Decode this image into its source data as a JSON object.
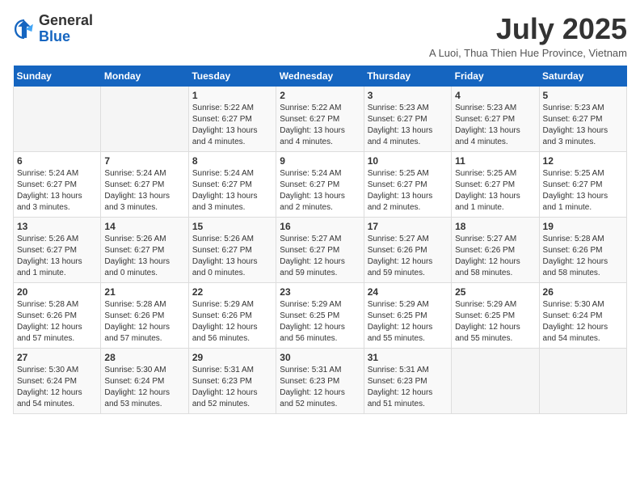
{
  "header": {
    "logo": {
      "general": "General",
      "blue": "Blue"
    },
    "month_title": "July 2025",
    "subtitle": "A Luoi, Thua Thien Hue Province, Vietnam"
  },
  "days_of_week": [
    "Sunday",
    "Monday",
    "Tuesday",
    "Wednesday",
    "Thursday",
    "Friday",
    "Saturday"
  ],
  "weeks": [
    [
      {
        "day": "",
        "sunrise": "",
        "sunset": "",
        "daylight": ""
      },
      {
        "day": "",
        "sunrise": "",
        "sunset": "",
        "daylight": ""
      },
      {
        "day": "1",
        "sunrise": "Sunrise: 5:22 AM",
        "sunset": "Sunset: 6:27 PM",
        "daylight": "Daylight: 13 hours and 4 minutes."
      },
      {
        "day": "2",
        "sunrise": "Sunrise: 5:22 AM",
        "sunset": "Sunset: 6:27 PM",
        "daylight": "Daylight: 13 hours and 4 minutes."
      },
      {
        "day": "3",
        "sunrise": "Sunrise: 5:23 AM",
        "sunset": "Sunset: 6:27 PM",
        "daylight": "Daylight: 13 hours and 4 minutes."
      },
      {
        "day": "4",
        "sunrise": "Sunrise: 5:23 AM",
        "sunset": "Sunset: 6:27 PM",
        "daylight": "Daylight: 13 hours and 4 minutes."
      },
      {
        "day": "5",
        "sunrise": "Sunrise: 5:23 AM",
        "sunset": "Sunset: 6:27 PM",
        "daylight": "Daylight: 13 hours and 3 minutes."
      }
    ],
    [
      {
        "day": "6",
        "sunrise": "Sunrise: 5:24 AM",
        "sunset": "Sunset: 6:27 PM",
        "daylight": "Daylight: 13 hours and 3 minutes."
      },
      {
        "day": "7",
        "sunrise": "Sunrise: 5:24 AM",
        "sunset": "Sunset: 6:27 PM",
        "daylight": "Daylight: 13 hours and 3 minutes."
      },
      {
        "day": "8",
        "sunrise": "Sunrise: 5:24 AM",
        "sunset": "Sunset: 6:27 PM",
        "daylight": "Daylight: 13 hours and 3 minutes."
      },
      {
        "day": "9",
        "sunrise": "Sunrise: 5:24 AM",
        "sunset": "Sunset: 6:27 PM",
        "daylight": "Daylight: 13 hours and 2 minutes."
      },
      {
        "day": "10",
        "sunrise": "Sunrise: 5:25 AM",
        "sunset": "Sunset: 6:27 PM",
        "daylight": "Daylight: 13 hours and 2 minutes."
      },
      {
        "day": "11",
        "sunrise": "Sunrise: 5:25 AM",
        "sunset": "Sunset: 6:27 PM",
        "daylight": "Daylight: 13 hours and 1 minute."
      },
      {
        "day": "12",
        "sunrise": "Sunrise: 5:25 AM",
        "sunset": "Sunset: 6:27 PM",
        "daylight": "Daylight: 13 hours and 1 minute."
      }
    ],
    [
      {
        "day": "13",
        "sunrise": "Sunrise: 5:26 AM",
        "sunset": "Sunset: 6:27 PM",
        "daylight": "Daylight: 13 hours and 1 minute."
      },
      {
        "day": "14",
        "sunrise": "Sunrise: 5:26 AM",
        "sunset": "Sunset: 6:27 PM",
        "daylight": "Daylight: 13 hours and 0 minutes."
      },
      {
        "day": "15",
        "sunrise": "Sunrise: 5:26 AM",
        "sunset": "Sunset: 6:27 PM",
        "daylight": "Daylight: 13 hours and 0 minutes."
      },
      {
        "day": "16",
        "sunrise": "Sunrise: 5:27 AM",
        "sunset": "Sunset: 6:27 PM",
        "daylight": "Daylight: 12 hours and 59 minutes."
      },
      {
        "day": "17",
        "sunrise": "Sunrise: 5:27 AM",
        "sunset": "Sunset: 6:26 PM",
        "daylight": "Daylight: 12 hours and 59 minutes."
      },
      {
        "day": "18",
        "sunrise": "Sunrise: 5:27 AM",
        "sunset": "Sunset: 6:26 PM",
        "daylight": "Daylight: 12 hours and 58 minutes."
      },
      {
        "day": "19",
        "sunrise": "Sunrise: 5:28 AM",
        "sunset": "Sunset: 6:26 PM",
        "daylight": "Daylight: 12 hours and 58 minutes."
      }
    ],
    [
      {
        "day": "20",
        "sunrise": "Sunrise: 5:28 AM",
        "sunset": "Sunset: 6:26 PM",
        "daylight": "Daylight: 12 hours and 57 minutes."
      },
      {
        "day": "21",
        "sunrise": "Sunrise: 5:28 AM",
        "sunset": "Sunset: 6:26 PM",
        "daylight": "Daylight: 12 hours and 57 minutes."
      },
      {
        "day": "22",
        "sunrise": "Sunrise: 5:29 AM",
        "sunset": "Sunset: 6:26 PM",
        "daylight": "Daylight: 12 hours and 56 minutes."
      },
      {
        "day": "23",
        "sunrise": "Sunrise: 5:29 AM",
        "sunset": "Sunset: 6:25 PM",
        "daylight": "Daylight: 12 hours and 56 minutes."
      },
      {
        "day": "24",
        "sunrise": "Sunrise: 5:29 AM",
        "sunset": "Sunset: 6:25 PM",
        "daylight": "Daylight: 12 hours and 55 minutes."
      },
      {
        "day": "25",
        "sunrise": "Sunrise: 5:29 AM",
        "sunset": "Sunset: 6:25 PM",
        "daylight": "Daylight: 12 hours and 55 minutes."
      },
      {
        "day": "26",
        "sunrise": "Sunrise: 5:30 AM",
        "sunset": "Sunset: 6:24 PM",
        "daylight": "Daylight: 12 hours and 54 minutes."
      }
    ],
    [
      {
        "day": "27",
        "sunrise": "Sunrise: 5:30 AM",
        "sunset": "Sunset: 6:24 PM",
        "daylight": "Daylight: 12 hours and 54 minutes."
      },
      {
        "day": "28",
        "sunrise": "Sunrise: 5:30 AM",
        "sunset": "Sunset: 6:24 PM",
        "daylight": "Daylight: 12 hours and 53 minutes."
      },
      {
        "day": "29",
        "sunrise": "Sunrise: 5:31 AM",
        "sunset": "Sunset: 6:23 PM",
        "daylight": "Daylight: 12 hours and 52 minutes."
      },
      {
        "day": "30",
        "sunrise": "Sunrise: 5:31 AM",
        "sunset": "Sunset: 6:23 PM",
        "daylight": "Daylight: 12 hours and 52 minutes."
      },
      {
        "day": "31",
        "sunrise": "Sunrise: 5:31 AM",
        "sunset": "Sunset: 6:23 PM",
        "daylight": "Daylight: 12 hours and 51 minutes."
      },
      {
        "day": "",
        "sunrise": "",
        "sunset": "",
        "daylight": ""
      },
      {
        "day": "",
        "sunrise": "",
        "sunset": "",
        "daylight": ""
      }
    ]
  ]
}
